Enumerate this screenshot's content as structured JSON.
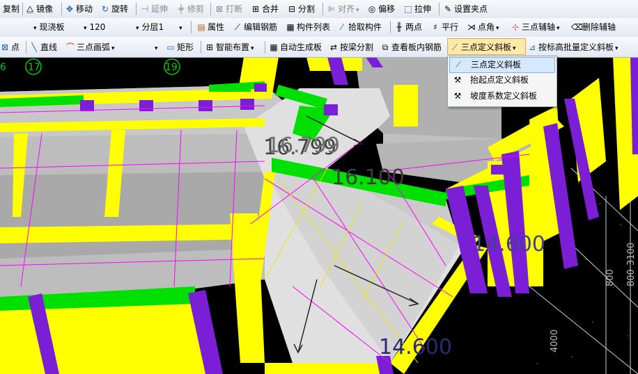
{
  "toolbar1": {
    "copy": "复制",
    "mirror": "镜像",
    "move": "移动",
    "rotate": "旋转",
    "extend": "延伸",
    "trim": "修剪",
    "break": "打断",
    "merge": "合并",
    "split": "分割",
    "align": "对齐",
    "offset": "偏移",
    "stretch": "拉伸",
    "set_grip": "设置夹点"
  },
  "toolbar2": {
    "type_value": "现浇板",
    "thickness_value": "120",
    "layer_value": "分层1",
    "properties": "属性",
    "edit_rebar": "编辑钢筋",
    "component_list": "构件列表",
    "pick_component": "拾取构件",
    "two_points": "两点",
    "parallel": "平行",
    "point_angle": "点角",
    "three_point_axis": "三点辅轴",
    "delete_axis": "删除辅轴"
  },
  "toolbar3": {
    "point": "点",
    "line": "直线",
    "three_point_arc": "三点画弧",
    "rectangle": "矩形",
    "smart_layout": "智能布置",
    "auto_generate_slab": "自动生成板",
    "split_by_beam": "按梁分割",
    "view_slab_rebar": "查看板内钢筋",
    "three_point_slope": "三点定义斜板",
    "batch_elevation_slope": "按标高批量定义斜板"
  },
  "dropdown": {
    "items": [
      "三点定义斜板",
      "抬起点定义斜板",
      "坡度系数定义斜板"
    ]
  },
  "viewport": {
    "axis_labels": [
      "6",
      "17",
      "19"
    ],
    "elevations": [
      "16.799",
      "16.100",
      "14.600",
      "14.600"
    ],
    "dimensions": [
      "3100",
      "800",
      "800",
      "4000"
    ]
  },
  "colors": {
    "beam_yellow": "#ffff00",
    "column_purple": "#7a1fd6",
    "slab_gray": "#bdbdbd",
    "slope_light": "#e0e0e0",
    "edge_green": "#00e000",
    "line_magenta": "#ff00ff",
    "menu_highlight": "#d6e8fb",
    "toolbar_bg": "#eef2f8"
  }
}
